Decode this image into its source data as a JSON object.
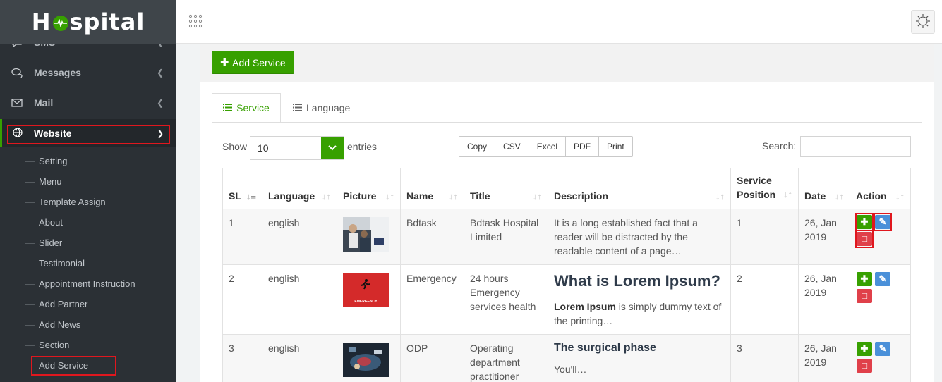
{
  "brand": {
    "name_left": "H",
    "name_right": "spital"
  },
  "sidebar": {
    "items": [
      {
        "label": "SMS",
        "icon": "chat-icon"
      },
      {
        "label": "Messages",
        "icon": "comments-icon"
      },
      {
        "label": "Mail",
        "icon": "envelope-icon"
      },
      {
        "label": "Website",
        "icon": "globe-icon"
      }
    ],
    "website_submenu": [
      "Setting",
      "Menu",
      "Template Assign",
      "About",
      "Slider",
      "Testimonial",
      "Appointment Instruction",
      "Add Partner",
      "Add News",
      "Section",
      "Add Service"
    ]
  },
  "toolbar": {
    "add_service_label": "Add Service"
  },
  "tabs": [
    {
      "label": "Service",
      "active": true
    },
    {
      "label": "Language",
      "active": false
    }
  ],
  "controls": {
    "show_label": "Show",
    "page_length": "10",
    "entries_label": "entries",
    "export_buttons": [
      "Copy",
      "CSV",
      "Excel",
      "PDF",
      "Print"
    ],
    "search_label": "Search:",
    "search_value": ""
  },
  "table": {
    "headers": [
      "SL",
      "Language",
      "Picture",
      "Name",
      "Title",
      "Description",
      "Service Position",
      "Date",
      "Action"
    ],
    "headers_split": {
      "service_position_1": "Service",
      "service_position_2": "Position"
    },
    "rows": [
      {
        "sl": "1",
        "language": "english",
        "name": "Bdtask",
        "title": "Bdtask Hospital Limited",
        "description": "It is a long established fact that a reader will be distracted by the readable content of a page…",
        "position": "1",
        "date": "26, Jan 2019"
      },
      {
        "sl": "2",
        "language": "english",
        "name": "Emergency",
        "title": "24 hours Emergency services health",
        "description_heading": "What is Lorem Ipsum?",
        "description_bold": "Lorem Ipsum",
        "description_rest": " is simply dummy text of the printing…",
        "picture_text": "EMERGENCY",
        "position": "2",
        "date": "26, Jan 2019"
      },
      {
        "sl": "3",
        "language": "english",
        "name": "ODP",
        "title": "Operating department practitioner",
        "description_heading": "The surgical phase",
        "description_rest": "You'll…",
        "position": "3",
        "date": "26, Jan 2019"
      }
    ]
  },
  "colors": {
    "accent": "#37a000",
    "sidebar_bg": "#2b3035",
    "highlight": "#e0171e"
  }
}
